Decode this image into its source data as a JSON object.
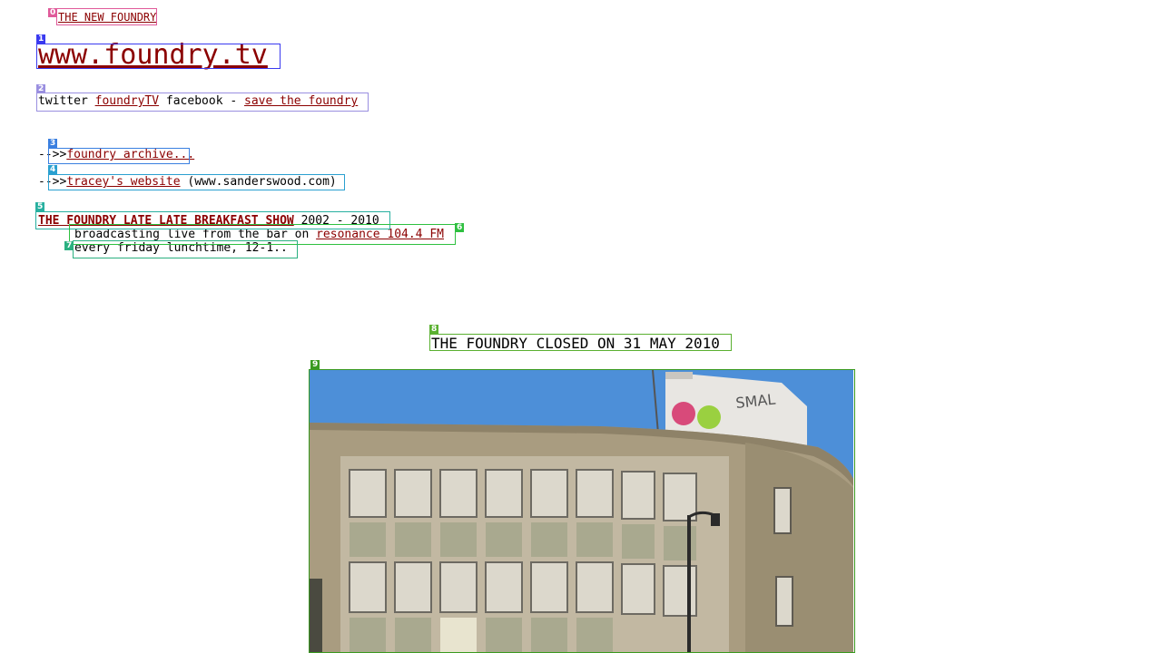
{
  "top_link": "THE NEW FOUNDRY",
  "site_title": "www.foundry.tv",
  "social": {
    "twitter_label": "twitter",
    "twitter_handle": "foundryTV",
    "facebook_label": "facebook",
    "separator": "-",
    "save_link": "save the foundry"
  },
  "links": [
    {
      "prefix": "-->>",
      "label": "foundry archive...",
      "suffix": ""
    },
    {
      "prefix": "-->>",
      "label": "tracey's website",
      "suffix": " (www.sanderswood.com)"
    }
  ],
  "show": {
    "title": "THE FOUNDRY LATE LATE BREAKFAST SHOW",
    "years": " 2002 - 2010",
    "broadcast_text": "broadcasting live from the bar on ",
    "station_link": "resonance 104.4 FM",
    "schedule": "every friday lunchtime, 12-1.."
  },
  "closed_notice": "THE FOUNDRY CLOSED ON 31 MAY 2010",
  "annotations": [
    "0",
    "1",
    "2",
    "3",
    "4",
    "5",
    "6",
    "7",
    "8",
    "9"
  ],
  "colors": {
    "link": "#8b0000",
    "box0": "#e05a9a",
    "box1": "#3a3af0",
    "box2": "#9a8fe0",
    "box3": "#3a7fe0",
    "box4": "#2aa0d0",
    "box5": "#28b0a0",
    "box6": "#2ec040",
    "box7": "#2ab080",
    "box8": "#5ab030",
    "box9": "#3a9a20"
  }
}
